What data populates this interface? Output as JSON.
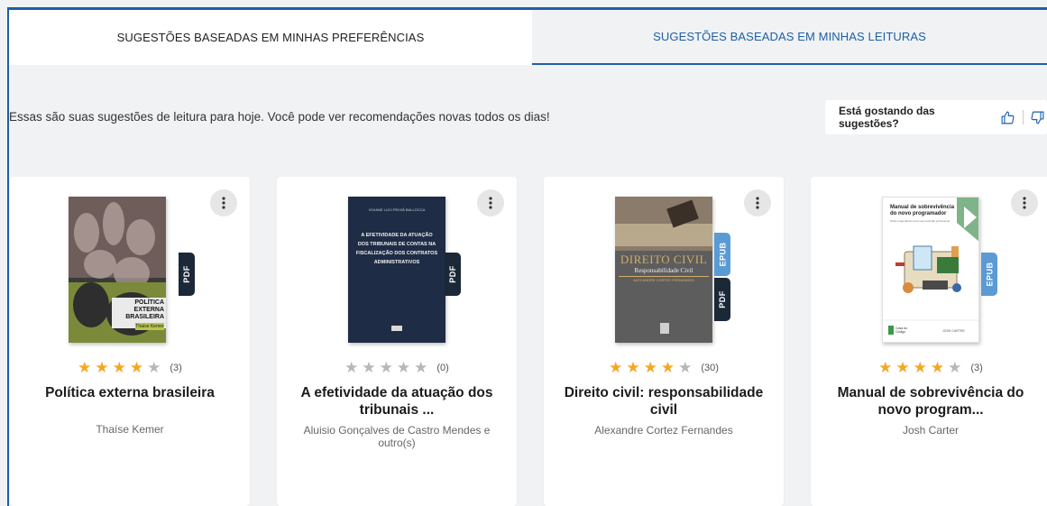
{
  "tabs": [
    {
      "label": "SUGESTÕES BASEADAS EM MINHAS PREFERÊNCIAS",
      "active": false
    },
    {
      "label": "SUGESTÕES BASEADAS EM MINHAS LEITURAS",
      "active": true
    }
  ],
  "intro_text": "Essas são suas sugestões de leitura para hoje. Você pode ver recomendações novas todos os dias!",
  "feedback": {
    "question": "Está gostando das sugestões?",
    "like_icon": "thumbs-up-icon",
    "dislike_icon": "thumbs-down-icon"
  },
  "books": [
    {
      "title": "Política externa brasileira",
      "author": "Thaíse Kemer",
      "rating": 4,
      "rating_count": "(3)",
      "formats": [
        "PDF"
      ],
      "cover": {
        "title": "POLÍTICA EXTERNA BRASILEIRA",
        "subtitle": "Thaíse Kemer"
      }
    },
    {
      "title": "A efetividade da atuação dos tribunais ...",
      "author": "Aluisio Gonçalves de Castro Mendes e outro(s)",
      "rating": 0,
      "rating_count": "(0)",
      "formats": [
        "PDF"
      ],
      "cover": {
        "title": "A EFETIVIDADE DA ATUAÇÃO DOS TRIBUNAIS DE CONTAS NA FISCALIZAÇÃO DOS CONTRATOS ADMINISTRATIVOS",
        "subtitle": "VIVIANE LUCI PEIXIÃ BALLOCCA"
      }
    },
    {
      "title": "Direito civil: responsabilidade civil",
      "author": "Alexandre Cortez Fernandes",
      "rating": 4,
      "rating_count": "(30)",
      "formats": [
        "EPUB",
        "PDF"
      ],
      "cover": {
        "title": "DIREITO CIVIL",
        "subtitle": "Responsabilidade Civil",
        "author": "ALEXANDRE CORTEZ FERNANDES"
      }
    },
    {
      "title": "Manual de sobrevivência do novo program...",
      "author": "Josh Carter",
      "rating": 4,
      "rating_count": "(3)",
      "formats": [
        "EPUB"
      ],
      "cover": {
        "title": "Manual de sobrevivência do novo programador",
        "subtitle": "Dicas pragmáticas para sua evolução profissional",
        "publisher": "Casa do Código",
        "author": "JOSH CARTER"
      }
    }
  ],
  "colors": {
    "accent": "#1d5fa8",
    "star": "#f5a623",
    "pdf_tag": "#1b2838",
    "epub_tag": "#5b9bd5"
  }
}
